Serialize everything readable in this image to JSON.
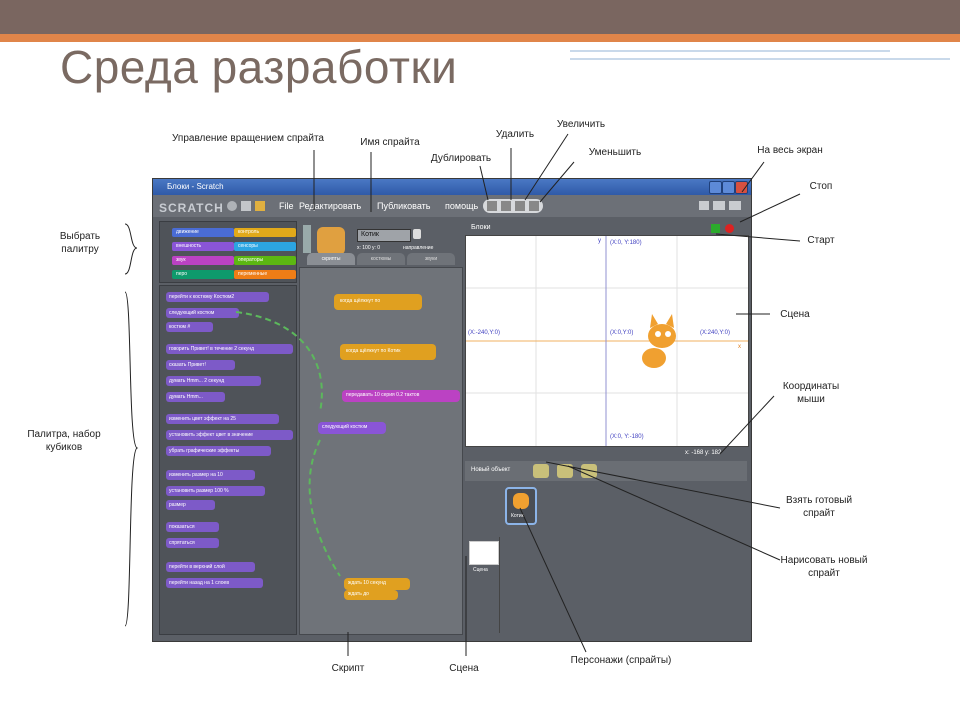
{
  "slide": {
    "title": "Среда разработки"
  },
  "window": {
    "title": "Блоки - Scratch",
    "logo": "SCRATCH",
    "menu": [
      "File",
      "Редактировать",
      "Публиковать",
      "помощь"
    ],
    "sprite_name": "Котик",
    "sprite_coords": "x: 100  y: 0",
    "sprite_direction": "направление",
    "tabs": [
      "скрипты",
      "костюмы",
      "звуки"
    ],
    "stage_title": "Блоки",
    "new_sprite_label": "Новый объект",
    "mouse_xy": "x: -168   y: 182",
    "sprite_thumb_label": "Котик",
    "stage_thumb_label": "Сцена",
    "stage_coords": {
      "top": "(X:0, Y:180)",
      "left": "(X:-240,Y:0)",
      "center": "(X:0,Y:0)",
      "right": "(X:240,Y:0)",
      "bottom": "(X:0, Y:-180)",
      "x_axis": "x",
      "y_axis": "y"
    },
    "palette_buttons": [
      {
        "label": "движение",
        "color": "#4a6cd4"
      },
      {
        "label": "контроль",
        "color": "#e1a91a"
      },
      {
        "label": "внешность",
        "color": "#8a55d7"
      },
      {
        "label": "сенсоры",
        "color": "#2ca5e2"
      },
      {
        "label": "звук",
        "color": "#bb42c3"
      },
      {
        "label": "операторы",
        "color": "#5cb712"
      },
      {
        "label": "перо",
        "color": "#0e9a6c"
      },
      {
        "label": "переменные",
        "color": "#ee7d16"
      }
    ],
    "palette_blocks": [
      "перейти к костюму Костюм2",
      "следующий костюм",
      "костюм #",
      "говорить Привет! в течение 2 секунд",
      "сказать Привет!",
      "думать Hmm... 2 секунд",
      "думать Hmm...",
      "изменить цвет эффект на 25",
      "установить эффект цвет в значение",
      "убрать графические эффекты",
      "изменить размер на 10",
      "установить размер 100 %",
      "размер",
      "показаться",
      "спрятаться",
      "перейти в верхний слой",
      "перейти назад на 1 слоев"
    ],
    "script_blocks": [
      "когда щёлкнут по",
      "когда щёлкнут по Котик",
      "передавать 10 серия 0.2 тактов",
      "следующий костюм",
      "ждать 10 секунд",
      "ждать до"
    ]
  },
  "annotations": {
    "rotation": "Управление вращением спрайта",
    "sprite_name": "Имя спрайта",
    "duplicate": "Дублировать",
    "delete": "Удалить",
    "grow": "Увеличить",
    "shrink": "Уменьшить",
    "fullscreen": "На весь экран",
    "stop": "Стоп",
    "start": "Старт",
    "choose_palette": "Выбрать палитру",
    "palette": "Палитра, набор кубиков",
    "stage": "Сцена",
    "mouse_coords": "Координаты мыши",
    "take_sprite": "Взять готовый спрайт",
    "paint_sprite": "Нарисовать новый спрайт",
    "script": "Скрипт",
    "stage_bottom": "Сцена",
    "sprites": "Персонажи (спрайты)"
  },
  "colors": {
    "header": "#7a6660",
    "accent": "#e0854a",
    "title": "#7a6a62"
  }
}
